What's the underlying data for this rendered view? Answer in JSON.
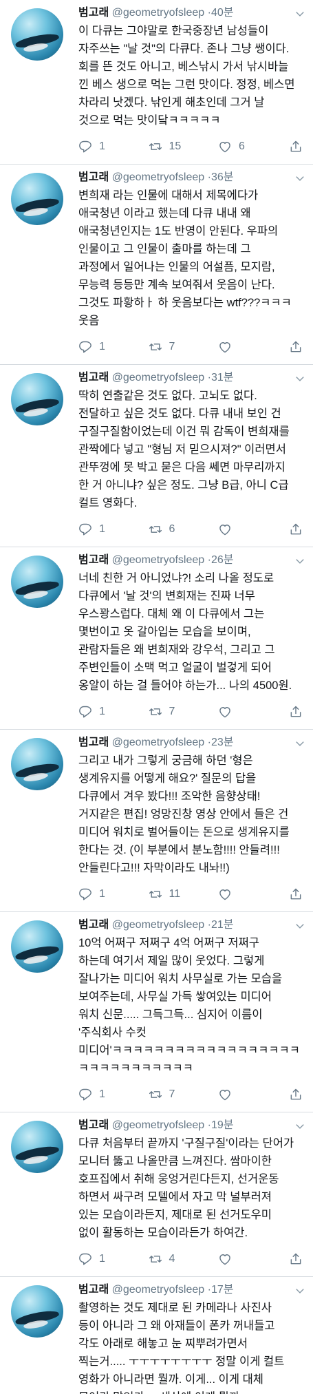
{
  "tweets": [
    {
      "name": "범고래",
      "handle": "@geometryofsleep",
      "time": "40분",
      "lines": [
        "이 다큐는 그야말로 한국중장년 남성들이",
        "자주쓰는 \"날 것\"의 다큐다. 존나 그냥 쌩이다.",
        "회를 뜬 것도 아니고, 베스낚시 가서 낚시바늘",
        "낀 베스 생으로 먹는 그런 맛이다. 정정, 베스면",
        "차라리 낫겠다. 낚인게 해초인데 그거 날",
        "것으로 먹는 맛이닼ㅋㅋㅋㅋㅋ"
      ],
      "replies": "1",
      "retweets": "15",
      "likes": "6"
    },
    {
      "name": "범고래",
      "handle": "@geometryofsleep",
      "time": "36분",
      "lines": [
        "변희재 라는 인물에 대해서 제목에다가",
        "애국청년 이라고 했는데 다큐 내내 왜",
        "애국청년인지는 1도 반영이 안된다. 우파의",
        "인물이고 그 인물이 출마를 하는데 그",
        "과정에서 일어나는 인물의 어설픔, 모지람,",
        "무능력 등등만 계속 보여줘서 웃음이 난다.",
        "그것도 파황하ㅏ 하 웃음보다는 wtf???ㅋㅋㅋ",
        "웃음"
      ],
      "replies": "1",
      "retweets": "7",
      "likes": ""
    },
    {
      "name": "범고래",
      "handle": "@geometryofsleep",
      "time": "31분",
      "lines": [
        "딱히 연출같은 것도 없다. 고뇌도 없다.",
        "전달하고 싶은 것도 없다. 다큐 내내 보인 건",
        "구질구질함이었는데 이건 뭐 감독이 변희재를",
        "관짝에다 넣고 \"형님 저 믿으시져?\" 이러면서",
        "관뚜껑에 못 박고 묻은 다음 쎄면 마무리까지",
        "한 거 아니냐? 싶은 정도. 그냥 B급, 아니 C급",
        "컬트 영화다."
      ],
      "replies": "1",
      "retweets": "6",
      "likes": ""
    },
    {
      "name": "범고래",
      "handle": "@geometryofsleep",
      "time": "26분",
      "lines": [
        "너네 친한 거 아니었냐?! 소리 나올 정도로",
        "다큐에서 '날 것'의 변희재는 진짜 너무",
        "우스꽝스럽다. 대체 왜 이 다큐에서 그는",
        "몇번이고 옷 갈아입는 모습을 보이며,",
        "관람자들은 왜 변희재와 강우석, 그리고 그",
        "주변인들이 소맥 먹고 얼굴이 벌겋게 되어",
        "옹알이 하는 걸 들어야 하는가... 나의 4500원."
      ],
      "replies": "1",
      "retweets": "7",
      "likes": ""
    },
    {
      "name": "범고래",
      "handle": "@geometryofsleep",
      "time": "23분",
      "lines": [
        "그리고 내가 그렇게 궁금해 하던 '형은",
        "생계유지를 어떻게 해요?' 질문의 답을",
        "다큐에서 겨우 봤다!!! 조악한 음향상태!",
        "거지같은 편집! 엉망진창 영상 안에서 들은 건",
        "미디어 워치로 벌어들이는 돈으로 생계유지를",
        "한다는 것. (이 부분에서 분노함!!!! 안들려!!!",
        "안들린다고!!! 자막이라도 내놔!!)"
      ],
      "replies": "1",
      "retweets": "11",
      "likes": ""
    },
    {
      "name": "범고래",
      "handle": "@geometryofsleep",
      "time": "21분",
      "lines": [
        "10억 어쩌구 저쩌구 4억 어쩌구 저쩌구",
        "하는데 여기서 제일 많이 웃었다. 그렇게",
        "잘나가는 미디어 워치 사무실로 가는 모습을",
        "보여주는데, 사무실 가득 쌓여있는 미디어",
        "워치 신문..... 그득그득... 심지어 이름이",
        "'주식회사 수컷",
        "미디어'ㅋㅋㅋㅋㅋㅋㅋㅋㅋㅋㅋㅋㅋㅋㅋㅋㅋㅋ",
        "ㅋㅋㅋㅋㅋㅋㅋㅋㅋㅋㅋ"
      ],
      "replies": "1",
      "retweets": "7",
      "likes": ""
    },
    {
      "name": "범고래",
      "handle": "@geometryofsleep",
      "time": "19분",
      "lines": [
        "다큐 처음부터 끝까지 '구질구질'이라는 단어가",
        "모니터 뚫고 나올만큼 느껴진다. 쌈마이한",
        "호프집에서 취해 웅엉거린다든지, 선거운동",
        "하면서 싸구려 모텔에서 자고 막 널부러져",
        "있는 모습이라든지, 제대로 된 선거도우미",
        "없이 활동하는 모습이라든가 하여간."
      ],
      "replies": "1",
      "retweets": "4",
      "likes": ""
    },
    {
      "name": "범고래",
      "handle": "@geometryofsleep",
      "time": "17분",
      "lines": [
        "촬영하는 것도 제대로 된 카메라나 사진사",
        "등이 아니라 그 왜 아재들이 폰카 꺼내들고",
        "각도 아래로 해놓고 눈 찌뿌려가면서",
        "찍는거..... ㅜㅜㅜㅜㅜㅜㅜㅜ 정말 이게 컬트",
        "영화가 아니라면 뭘까. 이게... 이게 대체",
        "무어란 말인가.... 세상에 이게 뭘까...."
      ],
      "replies": "",
      "retweets": "",
      "likes": ""
    }
  ]
}
